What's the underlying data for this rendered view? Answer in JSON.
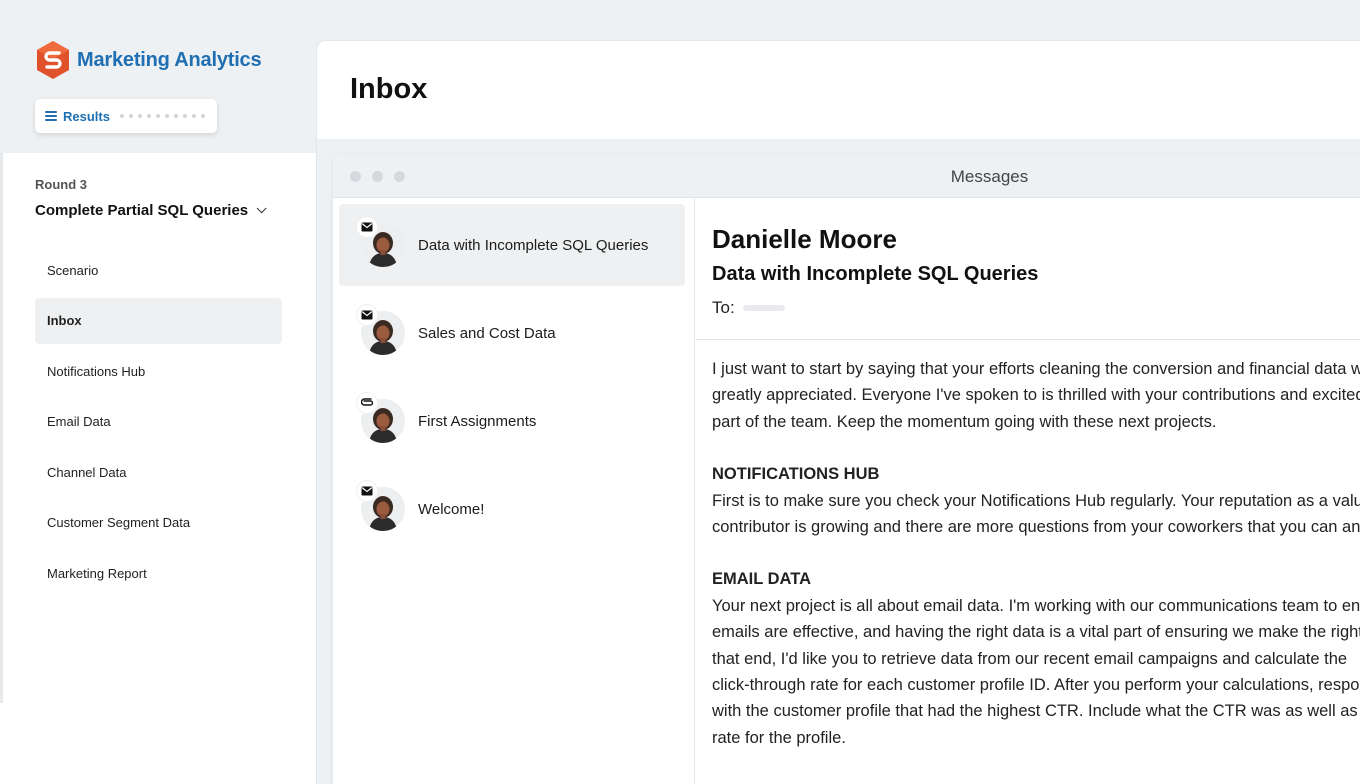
{
  "app": {
    "name": "Marketing Analytics",
    "brand_color": "#1f6fb2",
    "logo_color": "#e0522b",
    "results_label": "Results"
  },
  "sidebar": {
    "round_label": "Round 3",
    "round_title": "Complete Partial SQL Queries",
    "items": [
      {
        "label": "Scenario",
        "active": false
      },
      {
        "label": "Inbox",
        "active": true
      },
      {
        "label": "Notifications Hub",
        "active": false
      },
      {
        "label": "Email Data",
        "active": false
      },
      {
        "label": "Channel Data",
        "active": false
      },
      {
        "label": "Customer Segment Data",
        "active": false
      },
      {
        "label": "Marketing Report",
        "active": false
      }
    ]
  },
  "page": {
    "title": "Inbox"
  },
  "window": {
    "title": "Messages"
  },
  "messages": [
    {
      "subject": "Data with Incomplete SQL Queries",
      "icon": "envelope-icon",
      "active": true
    },
    {
      "subject": "Sales and Cost Data",
      "icon": "envelope-icon",
      "active": false
    },
    {
      "subject": "First Assignments",
      "icon": "paperclip-icon",
      "active": false
    },
    {
      "subject": "Welcome!",
      "icon": "envelope-icon",
      "active": false
    }
  ],
  "reader": {
    "sender": "Danielle Moore",
    "subject": "Data with Incomplete SQL Queries",
    "to_label": "To:",
    "body": {
      "intro": [
        "I just want to start by saying that your efforts cleaning the conversion and financial data were",
        "greatly appreciated. Everyone I've spoken to is thrilled with your contributions and excited you're",
        "part of the team. Keep the momentum going with these next projects."
      ],
      "section1_heading": "NOTIFICATIONS HUB",
      "section1": [
        "First is to make sure you check your Notifications Hub regularly. Your reputation as a valuable",
        "contributor is growing and there are more questions from your coworkers that you can answer."
      ],
      "section2_heading": "EMAIL DATA",
      "section2": [
        "Your next project is all about email data. I'm working with our communications team to ensure",
        "emails are effective, and having the right data is a vital part of ensuring we make the right calls. To",
        "that end, I'd like you to retrieve data from our recent email campaigns and calculate the",
        "click-through rate for each customer profile ID. After you perform your calculations, respond",
        "with the customer profile that had the highest CTR. Include what the CTR was as well as the open",
        "rate for the profile."
      ]
    }
  }
}
